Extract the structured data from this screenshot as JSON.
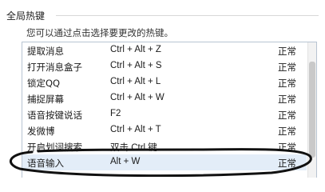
{
  "group": {
    "title": "全局热键"
  },
  "hint": "您可以通过点击选择要更改的热键。",
  "hotkeys": [
    {
      "name": "提取消息",
      "key": "Ctrl + Alt + Z",
      "status": "正常"
    },
    {
      "name": "打开消息盒子",
      "key": "Ctrl + Alt + S",
      "status": "正常"
    },
    {
      "name": "锁定QQ",
      "key": "Ctrl + Alt + L",
      "status": "正常"
    },
    {
      "name": "捕捉屏幕",
      "key": "Ctrl + Alt + W",
      "status": "正常"
    },
    {
      "name": "语音按键说话",
      "key": "F2",
      "status": "正常"
    },
    {
      "name": "发微博",
      "key": "Ctrl + Alt + T",
      "status": "正常"
    },
    {
      "name": "开启划词搜索",
      "key": "双击 Ctrl 键",
      "status": "正常"
    },
    {
      "name": "语音输入",
      "key": "Alt + W",
      "status": "正常"
    }
  ],
  "annotation_color": "#111111",
  "selected_row_color": "#e3edf8"
}
